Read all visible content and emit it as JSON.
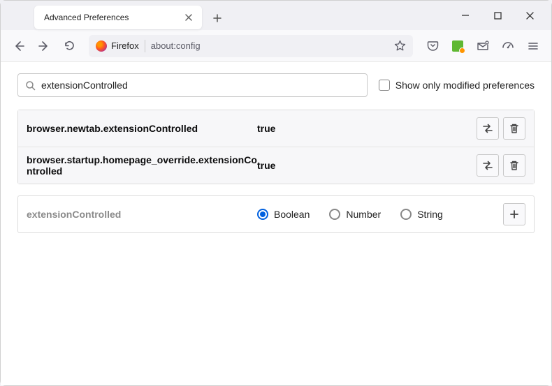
{
  "tab": {
    "title": "Advanced Preferences"
  },
  "url_bar": {
    "firefox_label": "Firefox",
    "url": "about:config"
  },
  "search": {
    "value": "extensionControlled",
    "modified_only_label": "Show only modified preferences"
  },
  "prefs": [
    {
      "name": "browser.newtab.extensionControlled",
      "value": "true"
    },
    {
      "name": "browser.startup.homepage_override.extensionControlled",
      "value": "true"
    }
  ],
  "new_pref": {
    "name": "extensionControlled",
    "types": {
      "boolean": "Boolean",
      "number": "Number",
      "string": "String"
    }
  }
}
